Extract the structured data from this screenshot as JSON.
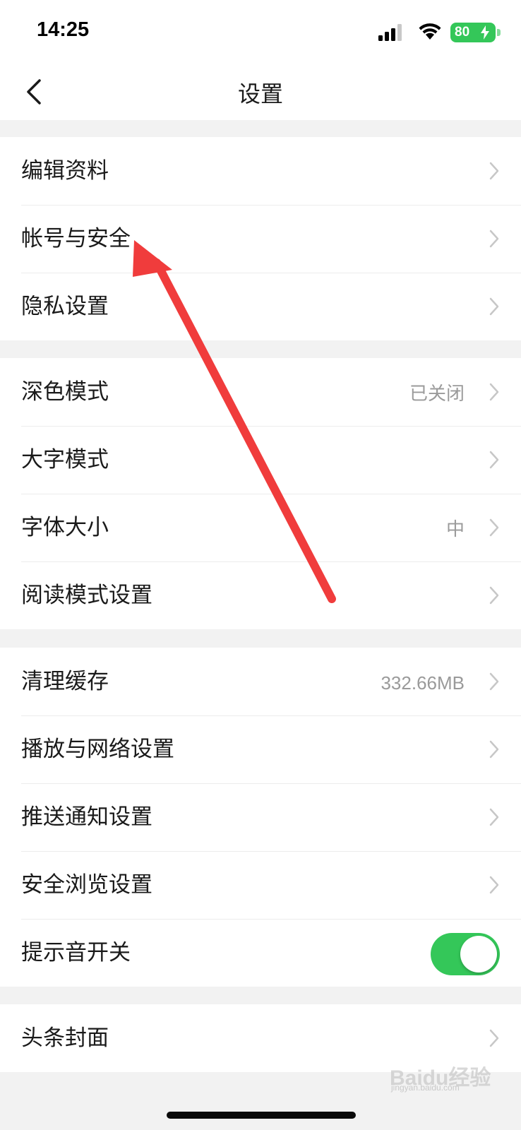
{
  "status_bar": {
    "time": "14:25",
    "battery_level": "80",
    "battery_color": "#34c759",
    "icons": [
      "signal-icon",
      "wifi-icon",
      "battery-icon"
    ]
  },
  "nav": {
    "title": "设置",
    "back_icon": "chevron-left-icon"
  },
  "groups": [
    {
      "items": [
        {
          "label": "编辑资料"
        },
        {
          "label": "帐号与安全"
        },
        {
          "label": "隐私设置"
        }
      ]
    },
    {
      "items": [
        {
          "label": "深色模式",
          "value": "已关闭"
        },
        {
          "label": "大字模式"
        },
        {
          "label": "字体大小",
          "value": "中"
        },
        {
          "label": "阅读模式设置"
        }
      ]
    },
    {
      "items": [
        {
          "label": "清理缓存",
          "value": "332.66MB"
        },
        {
          "label": "播放与网络设置"
        },
        {
          "label": "推送通知设置"
        },
        {
          "label": "安全浏览设置"
        },
        {
          "label": "提示音开关",
          "toggle_on": true
        }
      ]
    },
    {
      "items": [
        {
          "label": "头条封面"
        }
      ]
    }
  ],
  "colors": {
    "toggle_on": "#34c759",
    "annotation_arrow": "#f03c3c",
    "background": "#f2f2f2"
  },
  "watermark": {
    "text": "Baidu经验",
    "sub": "jingyan.baidu.com"
  }
}
